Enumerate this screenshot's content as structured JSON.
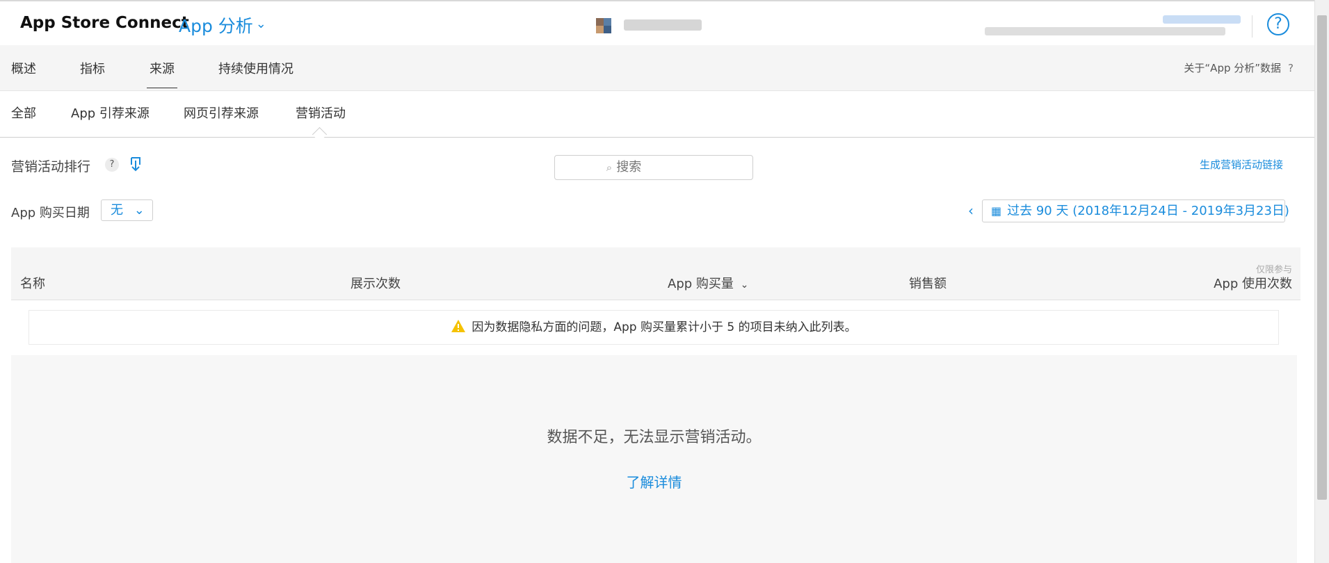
{
  "header": {
    "brand": "App Store Connect",
    "module": "App 分析",
    "help_glyph": "?"
  },
  "main_tabs": [
    {
      "label": "概述",
      "active": false
    },
    {
      "label": "指标",
      "active": false
    },
    {
      "label": "来源",
      "active": true
    },
    {
      "label": "持续使用情况",
      "active": false
    }
  ],
  "about_link": "关于“App 分析”数据",
  "about_q": "?",
  "sub_tabs": [
    {
      "label": "全部",
      "active": false
    },
    {
      "label": "App 引荐来源",
      "active": false
    },
    {
      "label": "网页引荐来源",
      "active": false
    },
    {
      "label": "营销活动",
      "active": true
    }
  ],
  "section": {
    "title": "营销活动排行",
    "help_glyph": "?",
    "search_placeholder": "搜索",
    "generate_link": "生成营销活动链接"
  },
  "filters": {
    "purchase_date_label": "App 购买日期",
    "purchase_date_value": "无",
    "range_label": "过去 90 天 (2018年12月24日 - 2019年3月23日)"
  },
  "table": {
    "columns": [
      "名称",
      "展示次数",
      "App 购买量",
      "销售额",
      "App 使用次数"
    ],
    "note": "仅限参与",
    "warning": "因为数据隐私方面的问题，App 购买量累计小于 5 的项目未纳入此列表。"
  },
  "empty_state": {
    "message": "数据不足，无法显示营销活动。",
    "learn_more": "了解详情"
  },
  "colors": {
    "accent": "#1a8cdc",
    "warning": "#f5c200"
  }
}
